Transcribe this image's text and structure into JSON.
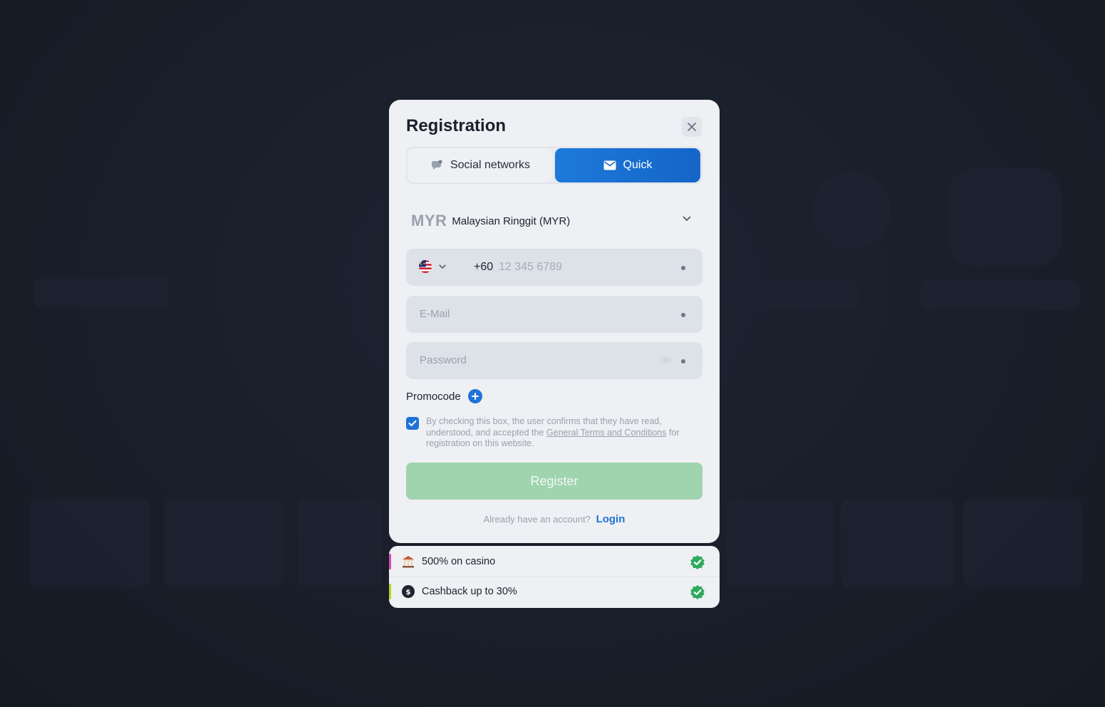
{
  "modal": {
    "title": "Registration",
    "tabs": [
      {
        "label": "Social networks",
        "icon": "chat-bubble-icon",
        "active": false
      },
      {
        "label": "Quick",
        "icon": "envelope-icon",
        "active": true
      }
    ],
    "currency": {
      "code": "MYR",
      "name": "Malaysian Ringgit (MYR)"
    },
    "phone": {
      "country_code": "+60",
      "placeholder": "12 345 6789",
      "flag": "malaysia-flag-icon"
    },
    "email": {
      "placeholder": "E-Mail"
    },
    "password": {
      "placeholder": "Password"
    },
    "promocode": {
      "label": "Promocode"
    },
    "agreement": {
      "checked": true,
      "text_before": "By checking this box, the user confirms that they have read, understood, and accepted the ",
      "link_text": "General Terms and Conditions",
      "text_after": " for registration on this website."
    },
    "register_label": "Register",
    "login": {
      "prompt": "Already have an account?",
      "link": "Login"
    }
  },
  "bonuses": [
    {
      "label": "500% on casino",
      "icon": "casino-building-icon",
      "stripe_color": "#d64ab0"
    },
    {
      "label": "Cashback up to 30%",
      "icon": "cashback-coin-icon",
      "stripe_color": "#b6d61a"
    }
  ],
  "colors": {
    "accent": "#1f73d6",
    "register_disabled": "#9fd4ae",
    "check_badge": "#2eaa5a"
  }
}
